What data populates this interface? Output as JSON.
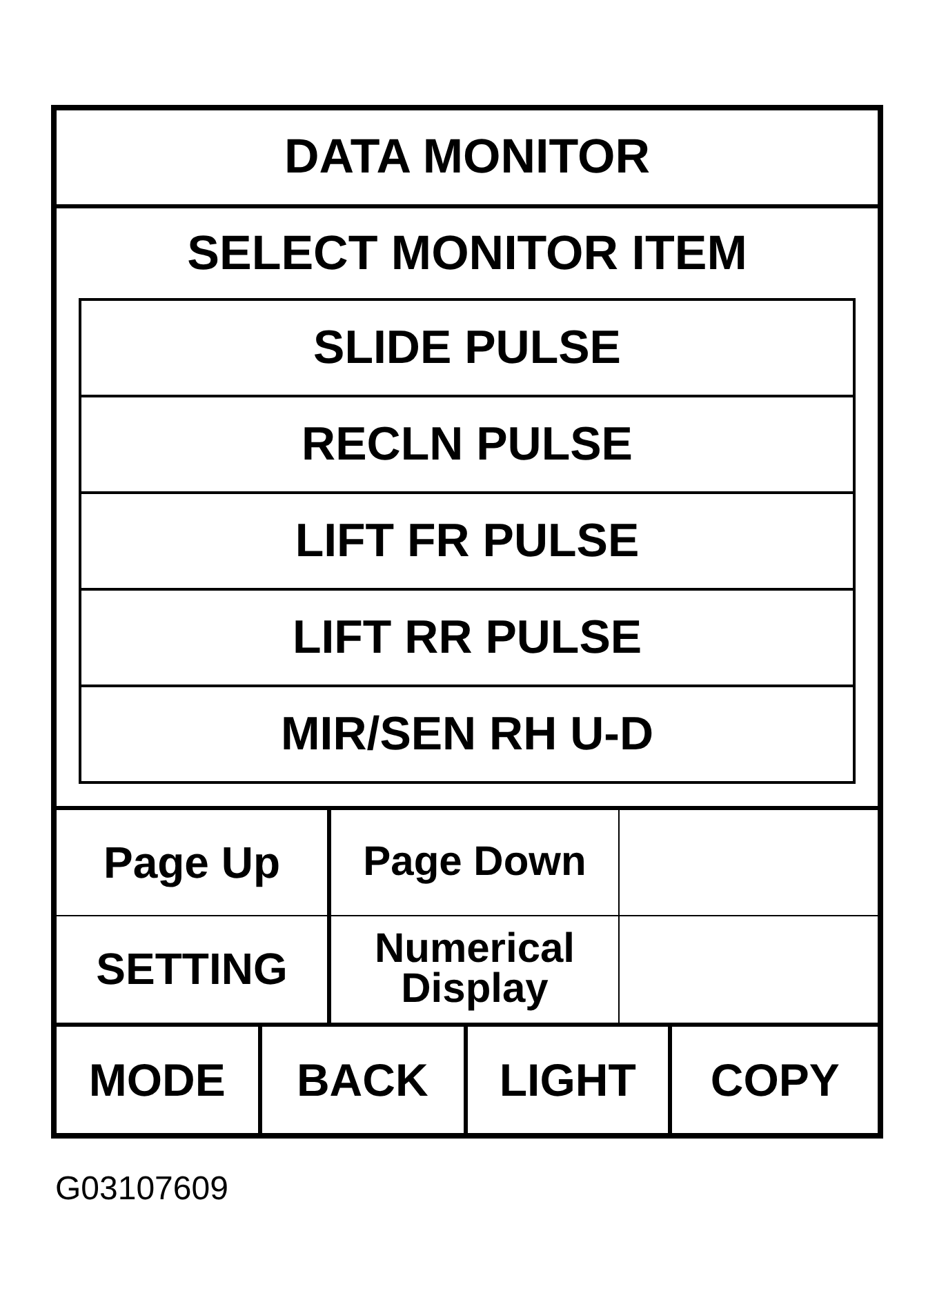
{
  "title": "DATA MONITOR",
  "subtitle": "SELECT MONITOR ITEM",
  "monitor_items": [
    "SLIDE PULSE",
    "RECLN PULSE",
    "LIFT FR PULSE",
    "LIFT RR PULSE",
    "MIR/SEN RH U-D"
  ],
  "soft_keys": [
    [
      "Page Up",
      "Page Down"
    ],
    [
      "SETTING",
      "Numerical Display"
    ]
  ],
  "function_keys": [
    "MODE",
    "BACK",
    "LIGHT",
    "COPY"
  ],
  "figure_id": "G03107609"
}
